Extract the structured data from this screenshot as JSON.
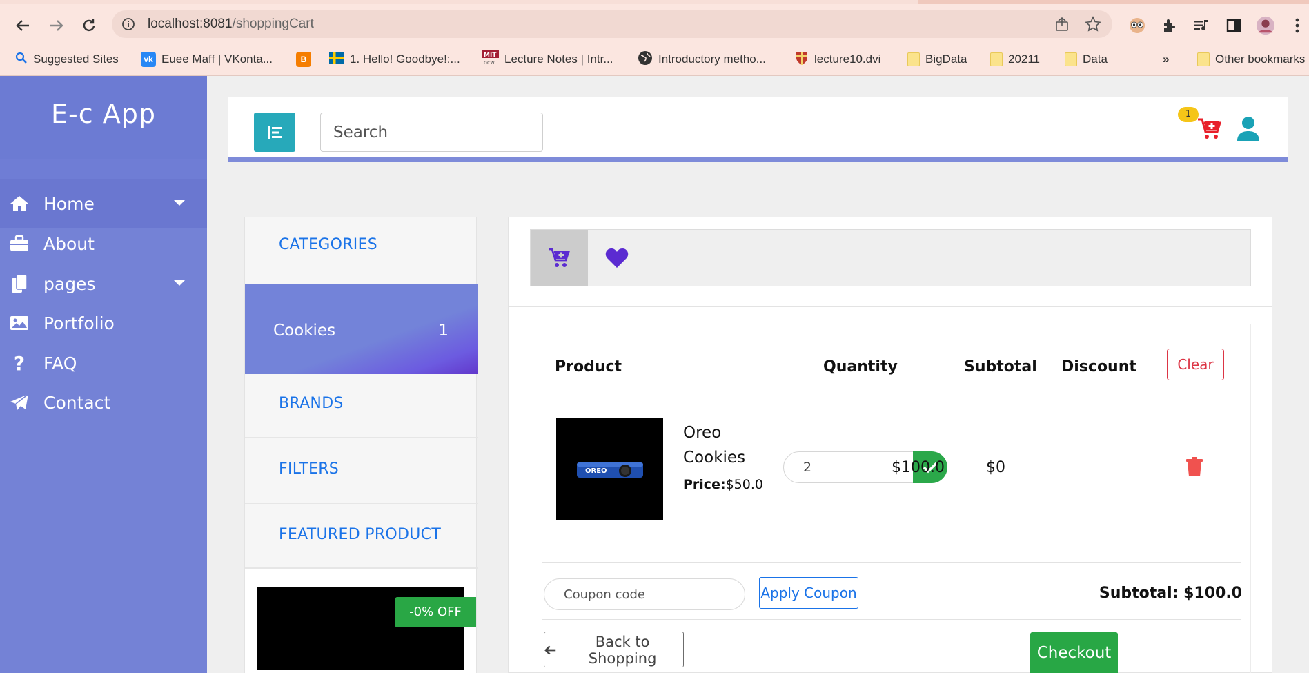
{
  "browser": {
    "url_host": "localhost:8081",
    "url_path": "/shoppingCart",
    "bookmarks": [
      {
        "label": "Suggested Sites",
        "icon": "search-icon",
        "color": "#1a73e8"
      },
      {
        "label": "Euee Maff | VKonta...",
        "icon": "vk-icon",
        "color": "#2787f5"
      },
      {
        "label": "",
        "icon": "blogger-icon",
        "color": "#f57d00"
      },
      {
        "label": "1. Hello! Goodbye!:...",
        "icon": "sweden-flag-icon",
        "color": "#006aa7"
      },
      {
        "label": "Lecture Notes | Intr...",
        "icon": "mit-ocw-icon",
        "color": "#a31f34"
      },
      {
        "label": "Introductory metho...",
        "icon": "globe-icon",
        "color": "#333333"
      },
      {
        "label": "lecture10.dvi",
        "icon": "cambridge-shield-icon",
        "color": "#c0392b"
      },
      {
        "label": "BigData",
        "icon": "folder-icon",
        "color": "#fbe38c"
      },
      {
        "label": "20211",
        "icon": "folder-icon",
        "color": "#fbe38c"
      },
      {
        "label": "Data",
        "icon": "folder-icon",
        "color": "#fbe38c"
      }
    ],
    "overflow": "»",
    "other_bookmarks": "Other bookmarks"
  },
  "sidebar": {
    "brand": "E-c App",
    "items": [
      {
        "label": "Home",
        "icon": "home-icon",
        "has_caret": true,
        "active": true
      },
      {
        "label": "About",
        "icon": "briefcase-icon",
        "has_caret": false
      },
      {
        "label": "pages",
        "icon": "copy-pages-icon",
        "has_caret": true
      },
      {
        "label": "Portfolio",
        "icon": "image-icon",
        "has_caret": false
      },
      {
        "label": "FAQ",
        "icon": "question-icon",
        "has_caret": false
      },
      {
        "label": "Contact",
        "icon": "paper-plane-icon",
        "has_caret": false
      }
    ]
  },
  "header": {
    "search_placeholder": "Search",
    "cart_badge": "1",
    "accent": "#27a9ba"
  },
  "left_panel": {
    "categories": "CATEGORIES",
    "category_item": {
      "name": "Cookies",
      "count": "1"
    },
    "brands": "BRANDS",
    "filters": "FILTERS",
    "featured": "FEATURED PRODUCT",
    "discount_badge": "-0% OFF"
  },
  "cart": {
    "headers": {
      "product": "Product",
      "quantity": "Quantity",
      "subtotal": "Subtotal",
      "discount": "Discount"
    },
    "clear_label": "Clear",
    "item": {
      "name": "Oreo Cookies",
      "price_label": "Price:",
      "price": "$50.0",
      "quantity": "2",
      "subtotal": "$100.0",
      "discount": "$0"
    },
    "coupon_placeholder": "Coupon code",
    "apply_label": "Apply Coupon",
    "total_label": "Subtotal: $100.0",
    "back_label": "Back to Shopping",
    "checkout_label": "Checkout"
  },
  "colors": {
    "sidebar": "#7482d6",
    "link_blue": "#1a73e8",
    "danger": "#dc3545",
    "success": "#28a745",
    "purple": "#5b2bd1"
  }
}
